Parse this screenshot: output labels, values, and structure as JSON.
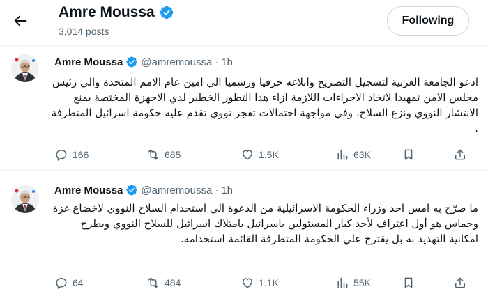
{
  "header": {
    "back_icon": "arrow-left-icon",
    "name": "Amre Moussa",
    "verified_icon": "verified-badge-icon",
    "posts": "3,014 posts",
    "follow_label": "Following"
  },
  "colors": {
    "verified": "#1d9bf0",
    "text": "#0f1419",
    "muted": "#536471",
    "divider": "#eff3f4"
  },
  "tweets": [
    {
      "name": "Amre Moussa",
      "handle": "@amremoussa",
      "dot": "·",
      "time": "1h",
      "text": "ادعو الجامعة العربية لتسجيل التصريح وابلاغه حرفيا ورسميا الي امين عام الامم المتحدة والي رئيس مجلس الامن تمهيدا لاتخاذ الاجراءات اللازمة ازاء هذا التطور الخطير لدي الاجهزة المختصة بمنع الانتشار النووي ونزع السلاح، وفي مواجهة احتمالات تفجر نووي تقدم عليه حكومة اسرائيل المتطرفة .",
      "replies": "166",
      "reposts": "685",
      "likes": "1.5K",
      "views": "63K"
    },
    {
      "name": "Amre Moussa",
      "handle": "@amremoussa",
      "dot": "·",
      "time": "1h",
      "text": "ما صرّح به امس احد وزراء الحكومة الاسرائيلية من الدعوة الي استخدام السلاح النووي لاخضاع غزة وحماس هو أول اعتراف لأحد كبار المسئولين باسرائيل بامتلاك اسرائيل للسلاح النووي ويطرح امكانية التهديد به بل يقترح علي الحكومة المتطرفة القائمة استخدامه.",
      "replies": "64",
      "reposts": "484",
      "likes": "1.1K",
      "views": "55K"
    }
  ]
}
